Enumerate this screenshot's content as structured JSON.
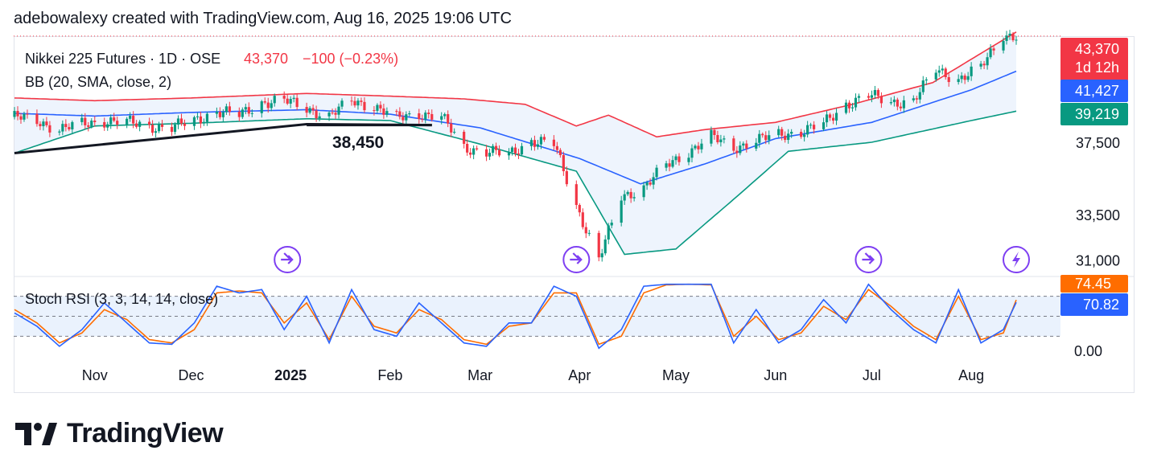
{
  "header": {
    "caption": "adebowalexy created with TradingView.com, Aug 16, 2025 19:06 UTC"
  },
  "brand": {
    "name": "TradingView",
    "logo_icon": "tradingview-logo-icon"
  },
  "legend": {
    "symbol": "Nikkei 225 Futures · 1D · OSE",
    "last": "43,370",
    "change": "−100 (−0.23%)",
    "indicator": "BB (20, SMA, close, 2)",
    "osc": "Stoch RSI (3, 3, 14, 14, close)"
  },
  "annotations": {
    "support_label": "38,450"
  },
  "price_tags": {
    "last": "43,370",
    "countdown": "1d 12h",
    "bb_basis": "41,427",
    "bb_lower": "39,219",
    "stoch_d": "74.45",
    "stoch_k": "70.82"
  },
  "colors": {
    "up": "#089981",
    "down": "#f23645",
    "bb_upper": "#f23645",
    "bb_basis": "#2962ff",
    "bb_lower": "#089981",
    "band_fill": "#eef4fd",
    "stoch_k": "#2962ff",
    "stoch_d": "#ff6d00",
    "trend": "#131722",
    "event": "#7e3ff2"
  },
  "chart_data": {
    "type": "candlestick",
    "axis_price": {
      "ticks": [
        37500,
        33500,
        31000
      ],
      "tick_labels": [
        "37,500",
        "33,500",
        "31,000"
      ]
    },
    "axis_osc": {
      "ticks": [
        0
      ],
      "tick_labels": [
        "0.00"
      ],
      "ylim": [
        0,
        100
      ],
      "levels": [
        80,
        50,
        20
      ]
    },
    "x_months": [
      {
        "label": "Nov",
        "date": "2024-11-01"
      },
      {
        "label": "Dec",
        "date": "2024-12-01"
      },
      {
        "label": "2025",
        "date": "2025-01-01",
        "bold": true
      },
      {
        "label": "Feb",
        "date": "2025-02-01"
      },
      {
        "label": "Mar",
        "date": "2025-03-01"
      },
      {
        "label": "Apr",
        "date": "2025-04-01"
      },
      {
        "label": "May",
        "date": "2025-05-01"
      },
      {
        "label": "Jun",
        "date": "2025-06-01"
      },
      {
        "label": "Jul",
        "date": "2025-07-01"
      },
      {
        "label": "Aug",
        "date": "2025-08-01"
      }
    ],
    "close_series": [
      [
        "2024-10-07",
        38900
      ],
      [
        "2024-10-14",
        38700
      ],
      [
        "2024-10-21",
        38200
      ],
      [
        "2024-10-28",
        38500
      ],
      [
        "2024-11-04",
        38700
      ],
      [
        "2024-11-11",
        38600
      ],
      [
        "2024-11-18",
        38400
      ],
      [
        "2024-11-25",
        38300
      ],
      [
        "2024-12-02",
        38700
      ],
      [
        "2024-12-09",
        39200
      ],
      [
        "2024-12-16",
        39000
      ],
      [
        "2024-12-23",
        39700
      ],
      [
        "2024-12-30",
        39800
      ],
      [
        "2025-01-06",
        39400
      ],
      [
        "2025-01-13",
        38900
      ],
      [
        "2025-01-20",
        39800
      ],
      [
        "2025-01-27",
        39500
      ],
      [
        "2025-02-03",
        38800
      ],
      [
        "2025-02-10",
        39100
      ],
      [
        "2025-02-17",
        38900
      ],
      [
        "2025-02-24",
        37200
      ],
      [
        "2025-03-03",
        37000
      ],
      [
        "2025-03-10",
        36800
      ],
      [
        "2025-03-17",
        37600
      ],
      [
        "2025-03-24",
        37400
      ],
      [
        "2025-03-31",
        34000
      ],
      [
        "2025-04-07",
        31000
      ],
      [
        "2025-04-14",
        34500
      ],
      [
        "2025-04-21",
        35000
      ],
      [
        "2025-04-28",
        36200
      ],
      [
        "2025-05-05",
        37000
      ],
      [
        "2025-05-12",
        37800
      ],
      [
        "2025-05-19",
        37200
      ],
      [
        "2025-05-26",
        37600
      ],
      [
        "2025-06-02",
        37900
      ],
      [
        "2025-06-09",
        38100
      ],
      [
        "2025-06-16",
        38500
      ],
      [
        "2025-06-23",
        39600
      ],
      [
        "2025-06-30",
        40100
      ],
      [
        "2025-07-07",
        39700
      ],
      [
        "2025-07-14",
        39800
      ],
      [
        "2025-07-21",
        41500
      ],
      [
        "2025-07-28",
        41000
      ],
      [
        "2025-08-04",
        41600
      ],
      [
        "2025-08-11",
        43470
      ],
      [
        "2025-08-15",
        43370
      ]
    ],
    "bb_upper": [
      [
        "2024-10-07",
        39950
      ],
      [
        "2024-11-01",
        39800
      ],
      [
        "2024-12-01",
        39950
      ],
      [
        "2025-01-06",
        40200
      ],
      [
        "2025-02-01",
        40050
      ],
      [
        "2025-02-24",
        39900
      ],
      [
        "2025-03-15",
        39600
      ],
      [
        "2025-03-31",
        38400
      ],
      [
        "2025-04-10",
        39000
      ],
      [
        "2025-04-25",
        37800
      ],
      [
        "2025-05-10",
        38200
      ],
      [
        "2025-06-01",
        38600
      ],
      [
        "2025-06-25",
        39600
      ],
      [
        "2025-07-20",
        40800
      ],
      [
        "2025-08-15",
        43600
      ]
    ],
    "bb_basis": [
      [
        "2024-10-07",
        39100
      ],
      [
        "2024-11-01",
        38950
      ],
      [
        "2024-12-01",
        39150
      ],
      [
        "2025-01-06",
        39300
      ],
      [
        "2025-02-01",
        39050
      ],
      [
        "2025-03-01",
        38300
      ],
      [
        "2025-04-01",
        36600
      ],
      [
        "2025-04-20",
        35200
      ],
      [
        "2025-05-10",
        36300
      ],
      [
        "2025-06-01",
        37700
      ],
      [
        "2025-07-01",
        38600
      ],
      [
        "2025-08-01",
        40400
      ],
      [
        "2025-08-15",
        41427
      ]
    ],
    "bb_lower": [
      [
        "2024-10-07",
        36900
      ],
      [
        "2024-11-01",
        38400
      ],
      [
        "2024-12-01",
        38550
      ],
      [
        "2025-01-06",
        38800
      ],
      [
        "2025-02-01",
        38700
      ],
      [
        "2025-03-01",
        37400
      ],
      [
        "2025-03-31",
        35900
      ],
      [
        "2025-04-15",
        31300
      ],
      [
        "2025-05-01",
        31600
      ],
      [
        "2025-05-20",
        34500
      ],
      [
        "2025-06-05",
        37000
      ],
      [
        "2025-07-01",
        37500
      ],
      [
        "2025-08-01",
        38700
      ],
      [
        "2025-08-15",
        39219
      ]
    ],
    "trendline": [
      [
        "2024-10-07",
        36900
      ],
      [
        "2025-01-06",
        38500
      ],
      [
        "2025-02-14",
        38450
      ]
    ],
    "support_segment": {
      "from": "2025-01-06",
      "to": "2025-02-14",
      "value": 38450
    },
    "event_markers": [
      {
        "date": "2024-12-31",
        "icon": "earnings-arrow-icon"
      },
      {
        "date": "2025-03-31",
        "icon": "earnings-arrow-icon"
      },
      {
        "date": "2025-06-30",
        "icon": "earnings-arrow-icon"
      },
      {
        "date": "2025-08-15",
        "icon": "lightning-icon"
      }
    ],
    "stoch_k": [
      [
        "2024-10-07",
        55
      ],
      [
        "2024-10-14",
        35
      ],
      [
        "2024-10-21",
        5
      ],
      [
        "2024-10-28",
        30
      ],
      [
        "2024-11-04",
        70
      ],
      [
        "2024-11-11",
        40
      ],
      [
        "2024-11-18",
        10
      ],
      [
        "2024-11-25",
        8
      ],
      [
        "2024-12-02",
        40
      ],
      [
        "2024-12-09",
        95
      ],
      [
        "2024-12-16",
        85
      ],
      [
        "2024-12-23",
        90
      ],
      [
        "2024-12-30",
        30
      ],
      [
        "2025-01-06",
        80
      ],
      [
        "2025-01-13",
        10
      ],
      [
        "2025-01-20",
        90
      ],
      [
        "2025-01-27",
        30
      ],
      [
        "2025-02-03",
        20
      ],
      [
        "2025-02-10",
        70
      ],
      [
        "2025-02-17",
        40
      ],
      [
        "2025-02-24",
        10
      ],
      [
        "2025-03-03",
        5
      ],
      [
        "2025-03-10",
        40
      ],
      [
        "2025-03-17",
        40
      ],
      [
        "2025-03-24",
        95
      ],
      [
        "2025-03-31",
        80
      ],
      [
        "2025-04-07",
        2
      ],
      [
        "2025-04-14",
        30
      ],
      [
        "2025-04-21",
        95
      ],
      [
        "2025-04-28",
        98
      ],
      [
        "2025-05-05",
        98
      ],
      [
        "2025-05-12",
        98
      ],
      [
        "2025-05-19",
        10
      ],
      [
        "2025-05-26",
        60
      ],
      [
        "2025-06-02",
        10
      ],
      [
        "2025-06-09",
        30
      ],
      [
        "2025-06-16",
        75
      ],
      [
        "2025-06-23",
        40
      ],
      [
        "2025-06-30",
        98
      ],
      [
        "2025-07-07",
        60
      ],
      [
        "2025-07-14",
        30
      ],
      [
        "2025-07-21",
        10
      ],
      [
        "2025-07-28",
        90
      ],
      [
        "2025-08-04",
        10
      ],
      [
        "2025-08-11",
        30
      ],
      [
        "2025-08-15",
        70.82
      ]
    ],
    "stoch_d": [
      [
        "2024-10-07",
        60
      ],
      [
        "2024-10-14",
        40
      ],
      [
        "2024-10-21",
        10
      ],
      [
        "2024-10-28",
        25
      ],
      [
        "2024-11-04",
        60
      ],
      [
        "2024-11-11",
        45
      ],
      [
        "2024-11-18",
        15
      ],
      [
        "2024-11-25",
        10
      ],
      [
        "2024-12-02",
        30
      ],
      [
        "2024-12-09",
        85
      ],
      [
        "2024-12-16",
        88
      ],
      [
        "2024-12-23",
        85
      ],
      [
        "2024-12-30",
        40
      ],
      [
        "2025-01-06",
        70
      ],
      [
        "2025-01-13",
        15
      ],
      [
        "2025-01-20",
        80
      ],
      [
        "2025-01-27",
        35
      ],
      [
        "2025-02-03",
        25
      ],
      [
        "2025-02-10",
        60
      ],
      [
        "2025-02-17",
        45
      ],
      [
        "2025-02-24",
        15
      ],
      [
        "2025-03-03",
        8
      ],
      [
        "2025-03-10",
        35
      ],
      [
        "2025-03-17",
        40
      ],
      [
        "2025-03-24",
        85
      ],
      [
        "2025-03-31",
        85
      ],
      [
        "2025-04-07",
        8
      ],
      [
        "2025-04-14",
        20
      ],
      [
        "2025-04-21",
        85
      ],
      [
        "2025-04-28",
        97
      ],
      [
        "2025-05-05",
        98
      ],
      [
        "2025-05-12",
        97
      ],
      [
        "2025-05-19",
        20
      ],
      [
        "2025-05-26",
        50
      ],
      [
        "2025-06-02",
        15
      ],
      [
        "2025-06-09",
        25
      ],
      [
        "2025-06-16",
        65
      ],
      [
        "2025-06-23",
        45
      ],
      [
        "2025-06-30",
        90
      ],
      [
        "2025-07-07",
        65
      ],
      [
        "2025-07-14",
        35
      ],
      [
        "2025-07-21",
        15
      ],
      [
        "2025-07-28",
        80
      ],
      [
        "2025-08-04",
        15
      ],
      [
        "2025-08-11",
        25
      ],
      [
        "2025-08-15",
        74.45
      ]
    ]
  }
}
